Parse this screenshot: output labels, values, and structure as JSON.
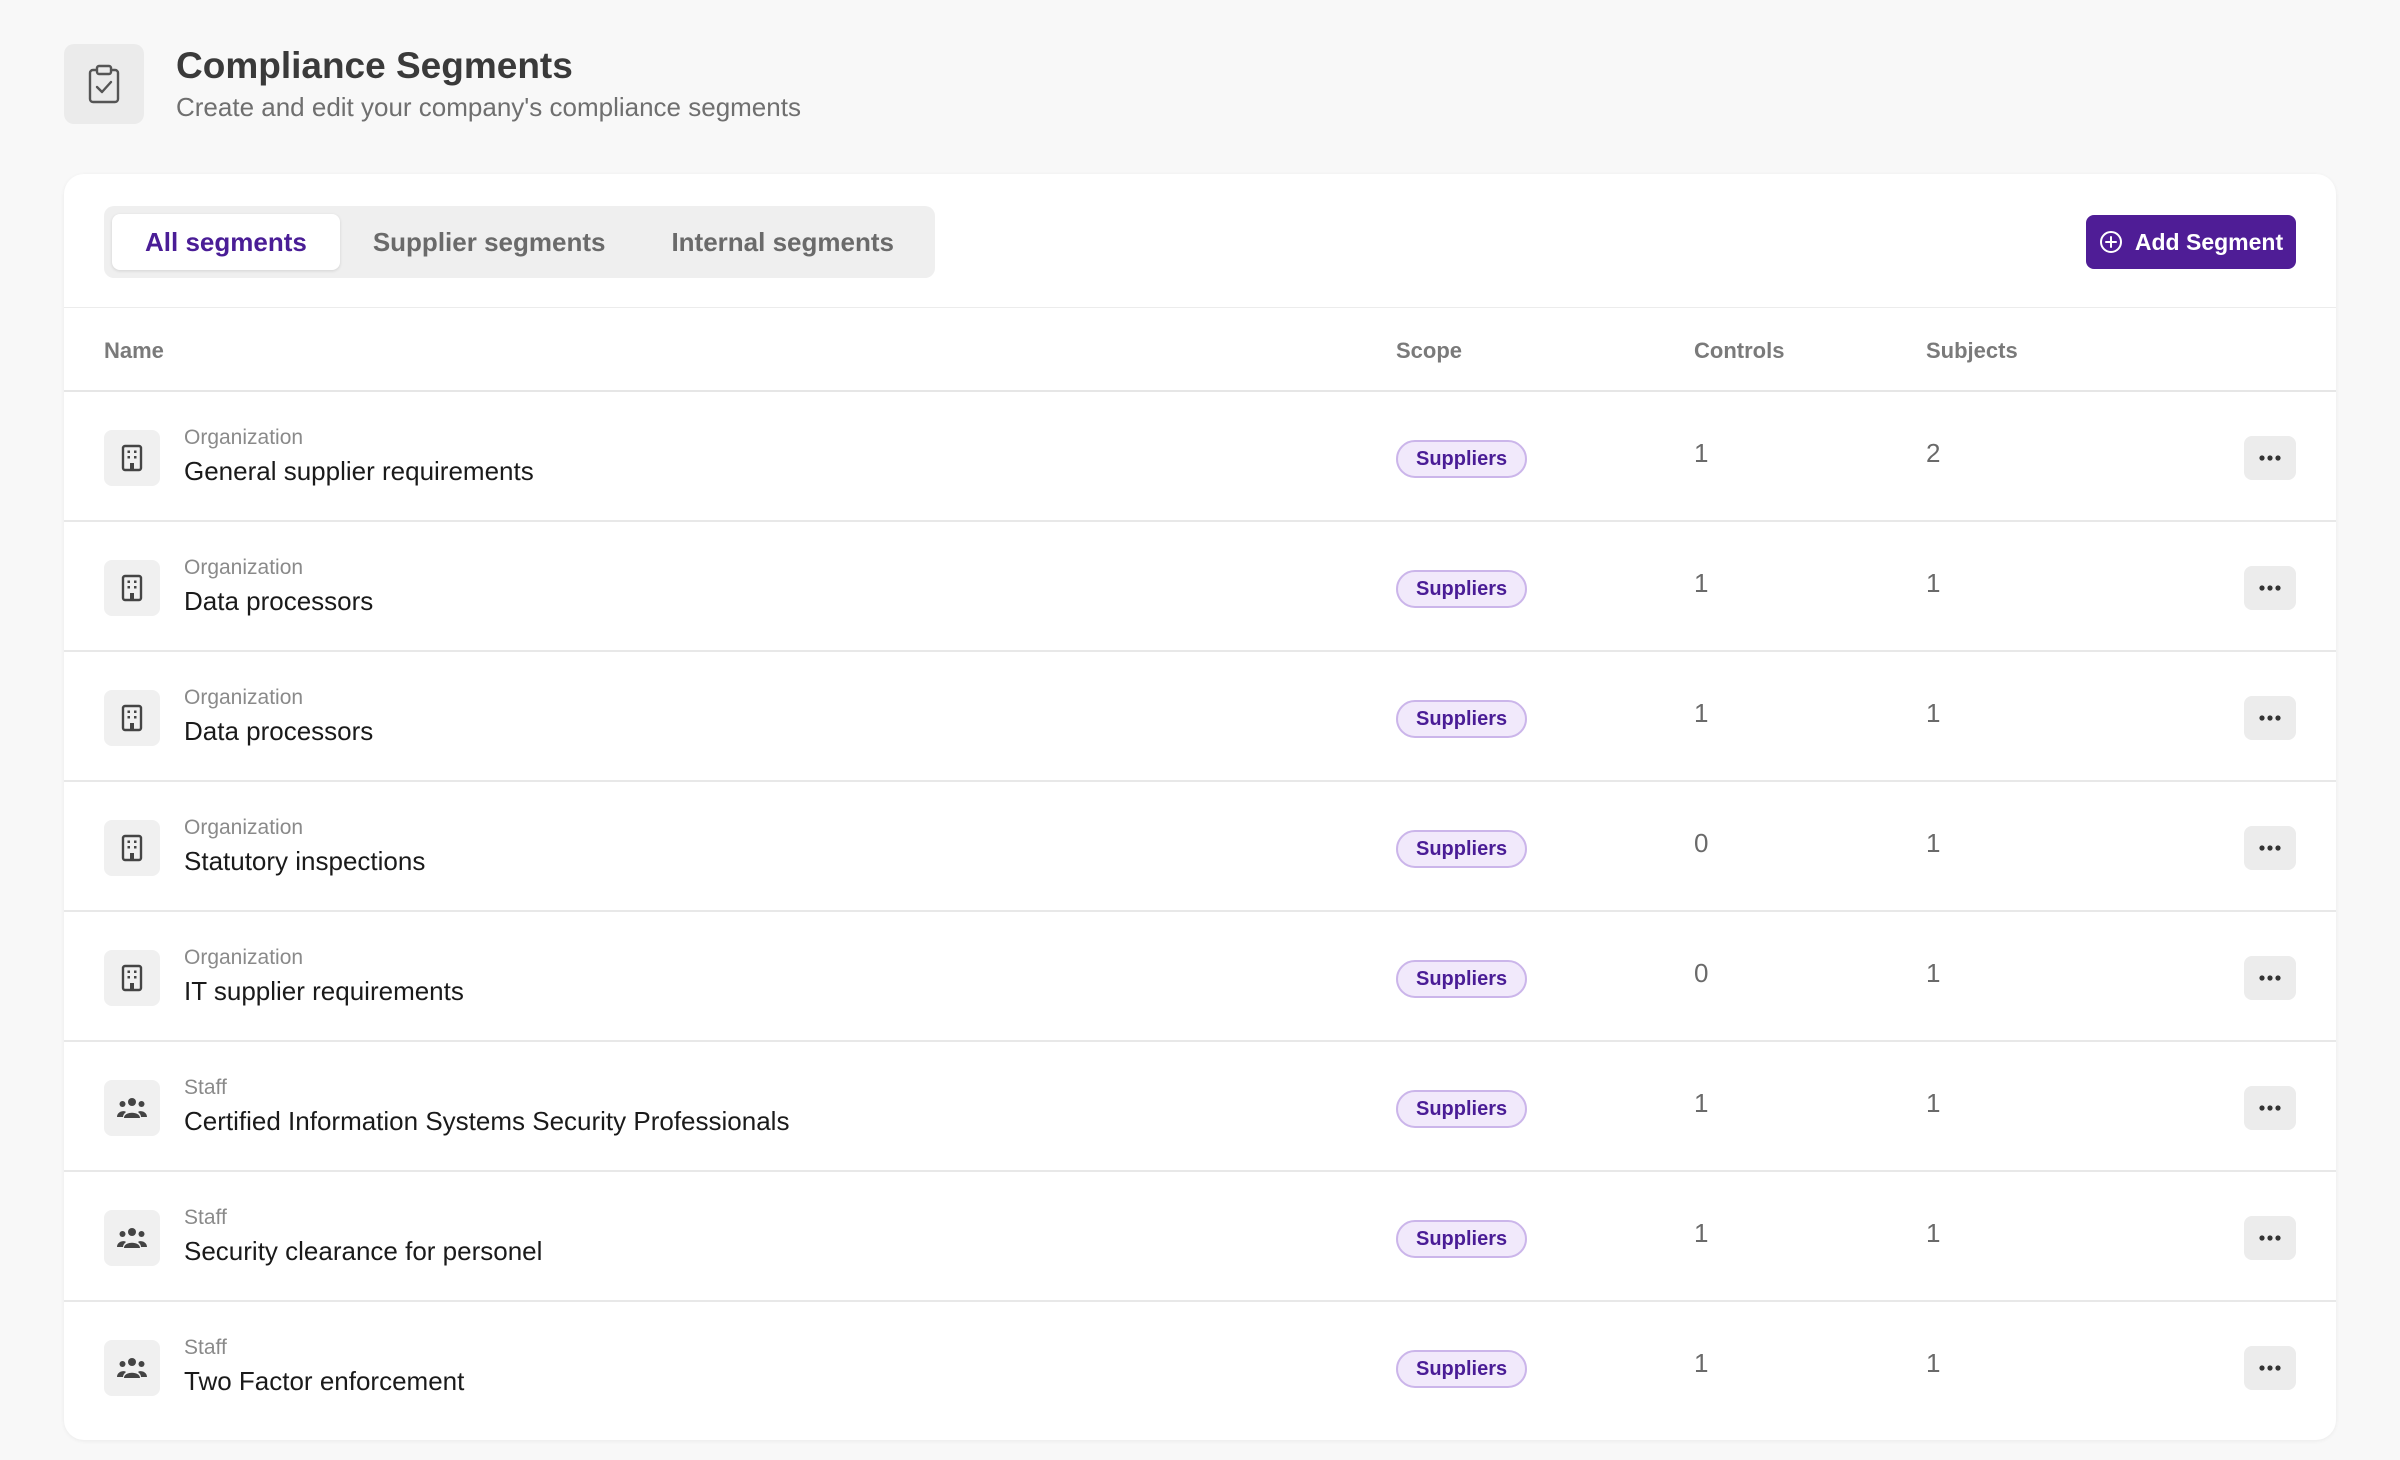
{
  "header": {
    "title": "Compliance Segments",
    "subtitle": "Create and edit your company's compliance segments",
    "icon": "clipboard-check-icon"
  },
  "tabs": [
    {
      "label": "All segments",
      "active": true
    },
    {
      "label": "Supplier segments",
      "active": false
    },
    {
      "label": "Internal segments",
      "active": false
    }
  ],
  "add_button": {
    "label": "Add Segment",
    "icon": "plus-circle-icon"
  },
  "columns": {
    "name": "Name",
    "scope": "Scope",
    "controls": "Controls",
    "subjects": "Subjects"
  },
  "colors": {
    "accent": "#4f1d96",
    "badge_bg": "#f1e9fb",
    "badge_border": "#cbb5ea"
  },
  "rows": [
    {
      "kind": "Organization",
      "name": "General supplier requirements",
      "scope": "Suppliers",
      "controls": "1",
      "subjects": "2",
      "icon": "building-icon"
    },
    {
      "kind": "Organization",
      "name": "Data processors",
      "scope": "Suppliers",
      "controls": "1",
      "subjects": "1",
      "icon": "building-icon"
    },
    {
      "kind": "Organization",
      "name": "Data processors",
      "scope": "Suppliers",
      "controls": "1",
      "subjects": "1",
      "icon": "building-icon"
    },
    {
      "kind": "Organization",
      "name": "Statutory inspections",
      "scope": "Suppliers",
      "controls": "0",
      "subjects": "1",
      "icon": "building-icon"
    },
    {
      "kind": "Organization",
      "name": "IT supplier requirements",
      "scope": "Suppliers",
      "controls": "0",
      "subjects": "1",
      "icon": "building-icon"
    },
    {
      "kind": "Staff",
      "name": "Certified Information Systems Security Professionals",
      "scope": "Suppliers",
      "controls": "1",
      "subjects": "1",
      "icon": "users-icon"
    },
    {
      "kind": "Staff",
      "name": "Security clearance for personel",
      "scope": "Suppliers",
      "controls": "1",
      "subjects": "1",
      "icon": "users-icon"
    },
    {
      "kind": "Staff",
      "name": "Two Factor enforcement",
      "scope": "Suppliers",
      "controls": "1",
      "subjects": "1",
      "icon": "users-icon"
    }
  ]
}
